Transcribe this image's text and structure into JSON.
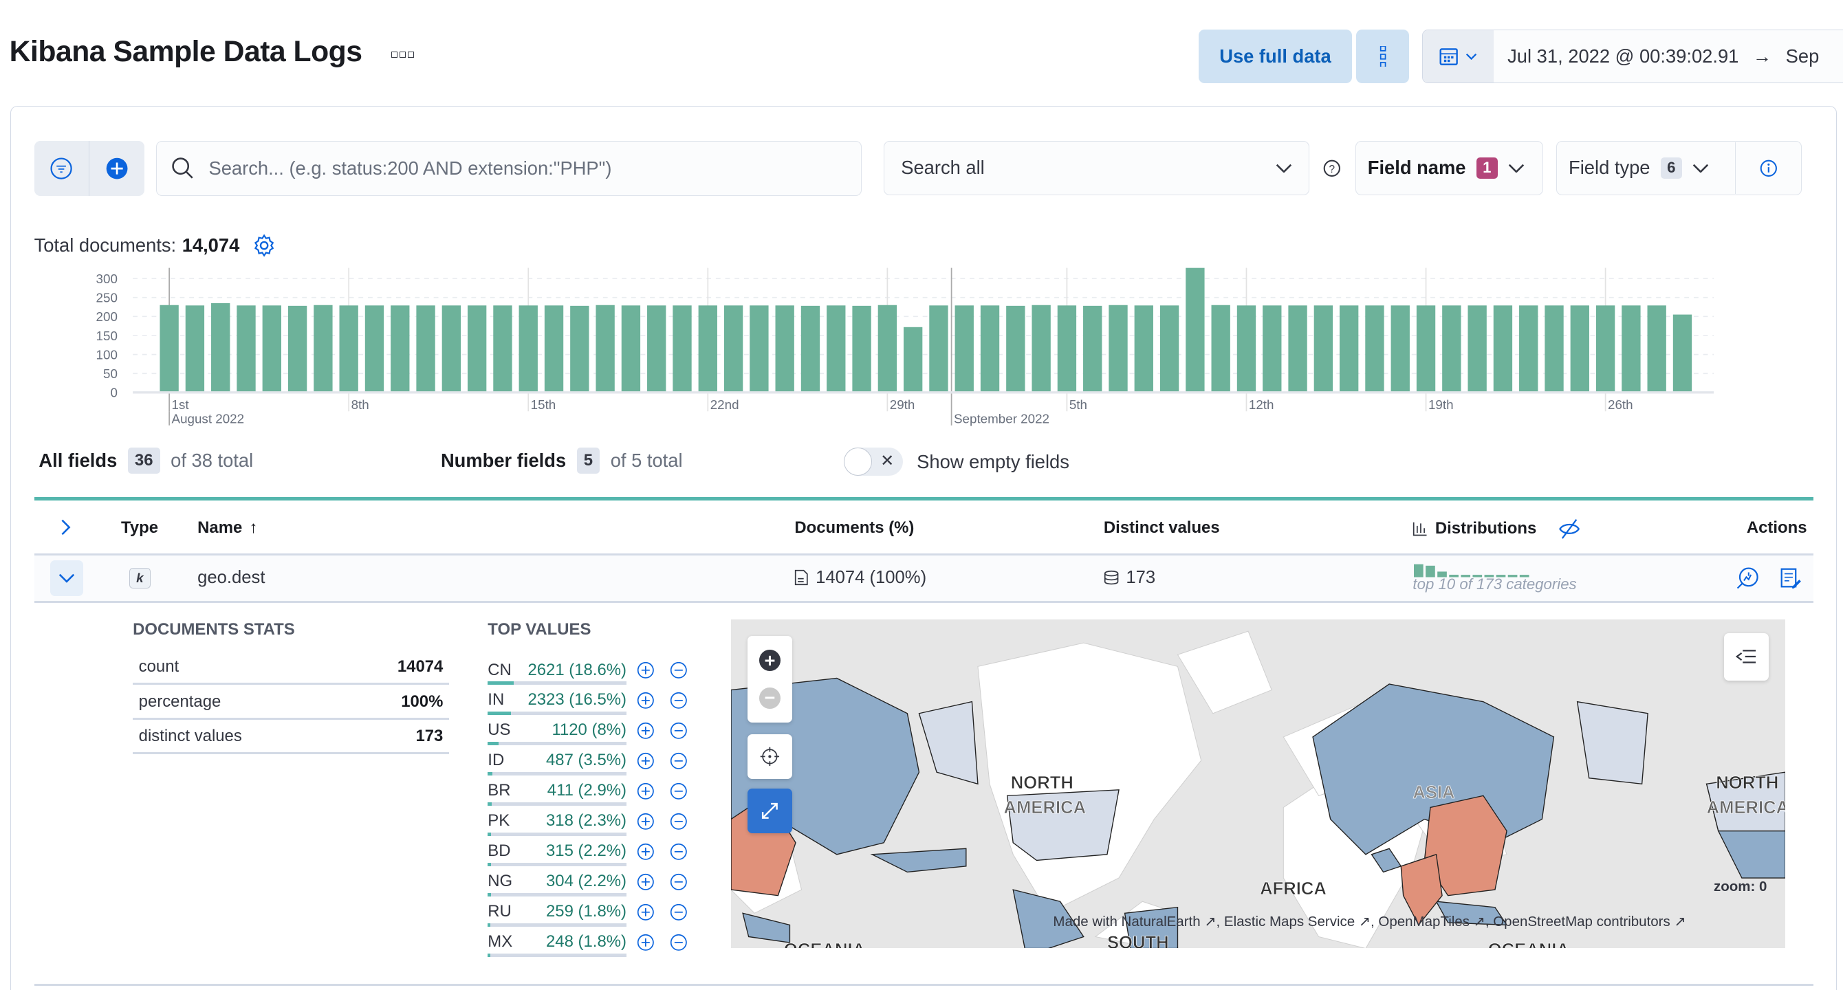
{
  "header": {
    "title": "Kibana Sample Data Logs",
    "use_full_data": "Use full data",
    "date_start": "Jul 31, 2022 @ 00:39:02.91",
    "date_end": "Sep"
  },
  "search": {
    "placeholder": "Search... (e.g. status:200 AND extension:\"PHP\")",
    "search_all": "Search all",
    "field_name": "Field name",
    "field_name_count": "1",
    "field_type": "Field type",
    "field_type_count": "6"
  },
  "total": {
    "label": "Total documents:",
    "value": "14,074"
  },
  "chart_data": {
    "type": "bar",
    "ylim": [
      0,
      330
    ],
    "yticks": [
      "0",
      "50",
      "100",
      "150",
      "200",
      "250",
      "300"
    ],
    "xticks": [
      "1st",
      "8th",
      "15th",
      "22nd",
      "29th",
      "5th",
      "12th",
      "19th",
      "26th"
    ],
    "month_labels": [
      "August 2022",
      "September 2022"
    ],
    "x_start": "2022-08-01",
    "x_end": "2022-09-29",
    "values": [
      230,
      229,
      235,
      229,
      229,
      228,
      230,
      229,
      229,
      229,
      229,
      229,
      229,
      229,
      229,
      229,
      228,
      230,
      229,
      229,
      229,
      229,
      229,
      229,
      229,
      228,
      229,
      228,
      230,
      172,
      229,
      229,
      229,
      228,
      230,
      229,
      228,
      230,
      229,
      229,
      328,
      230,
      229,
      229,
      229,
      229,
      229,
      229,
      229,
      229,
      229,
      229,
      229,
      229,
      229,
      229,
      229,
      229,
      229,
      205
    ],
    "color": "#6db29a"
  },
  "fields_summary": {
    "all_label": "All fields",
    "all_count": "36",
    "all_total": "of 38 total",
    "number_label": "Number fields",
    "number_count": "5",
    "number_total": "of 5 total",
    "show_empty": "Show empty fields"
  },
  "table": {
    "headers": {
      "type": "Type",
      "name": "Name",
      "documents": "Documents (%)",
      "distinct": "Distinct values",
      "distributions": "Distributions",
      "actions": "Actions"
    },
    "row": {
      "type_icon": "k",
      "name": "geo.dest",
      "documents": "14074 (100%)",
      "distinct": "173",
      "distribution_caption": "top 10 of 173 categories"
    }
  },
  "stats": {
    "title": "DOCUMENTS STATS",
    "rows": [
      {
        "label": "count",
        "value": "14074"
      },
      {
        "label": "percentage",
        "value": "100%"
      },
      {
        "label": "distinct values",
        "value": "173"
      }
    ]
  },
  "top_values": {
    "title": "TOP VALUES",
    "items": [
      {
        "key": "CN",
        "value": "2621 (18.6%)",
        "pct": 18.6
      },
      {
        "key": "IN",
        "value": "2323 (16.5%)",
        "pct": 16.5
      },
      {
        "key": "US",
        "value": "1120 (8%)",
        "pct": 8
      },
      {
        "key": "ID",
        "value": "487 (3.5%)",
        "pct": 3.5
      },
      {
        "key": "BR",
        "value": "411 (2.9%)",
        "pct": 2.9
      },
      {
        "key": "PK",
        "value": "318 (2.3%)",
        "pct": 2.3
      },
      {
        "key": "BD",
        "value": "315 (2.2%)",
        "pct": 2.2
      },
      {
        "key": "NG",
        "value": "304 (2.2%)",
        "pct": 2.2
      },
      {
        "key": "RU",
        "value": "259 (1.8%)",
        "pct": 1.8
      },
      {
        "key": "MX",
        "value": "248 (1.8%)",
        "pct": 1.8
      }
    ]
  },
  "map": {
    "labels": [
      "NORTH",
      "AMERICA",
      "ASIA",
      "AFRICA",
      "SOUTH",
      "OCEANIA",
      "NORTH",
      "AMERICA",
      "OCEANIA"
    ],
    "zoom": "zoom: 0",
    "attribution": "Made with NaturalEarth ↗, Elastic Maps Service ↗, OpenMapTiles ↗, OpenStreetMap contributors ↗",
    "colors": {
      "high": "#e0917a",
      "mid": "#8facc9",
      "low": "#d6dde9",
      "water": "#e6e6e6"
    }
  }
}
